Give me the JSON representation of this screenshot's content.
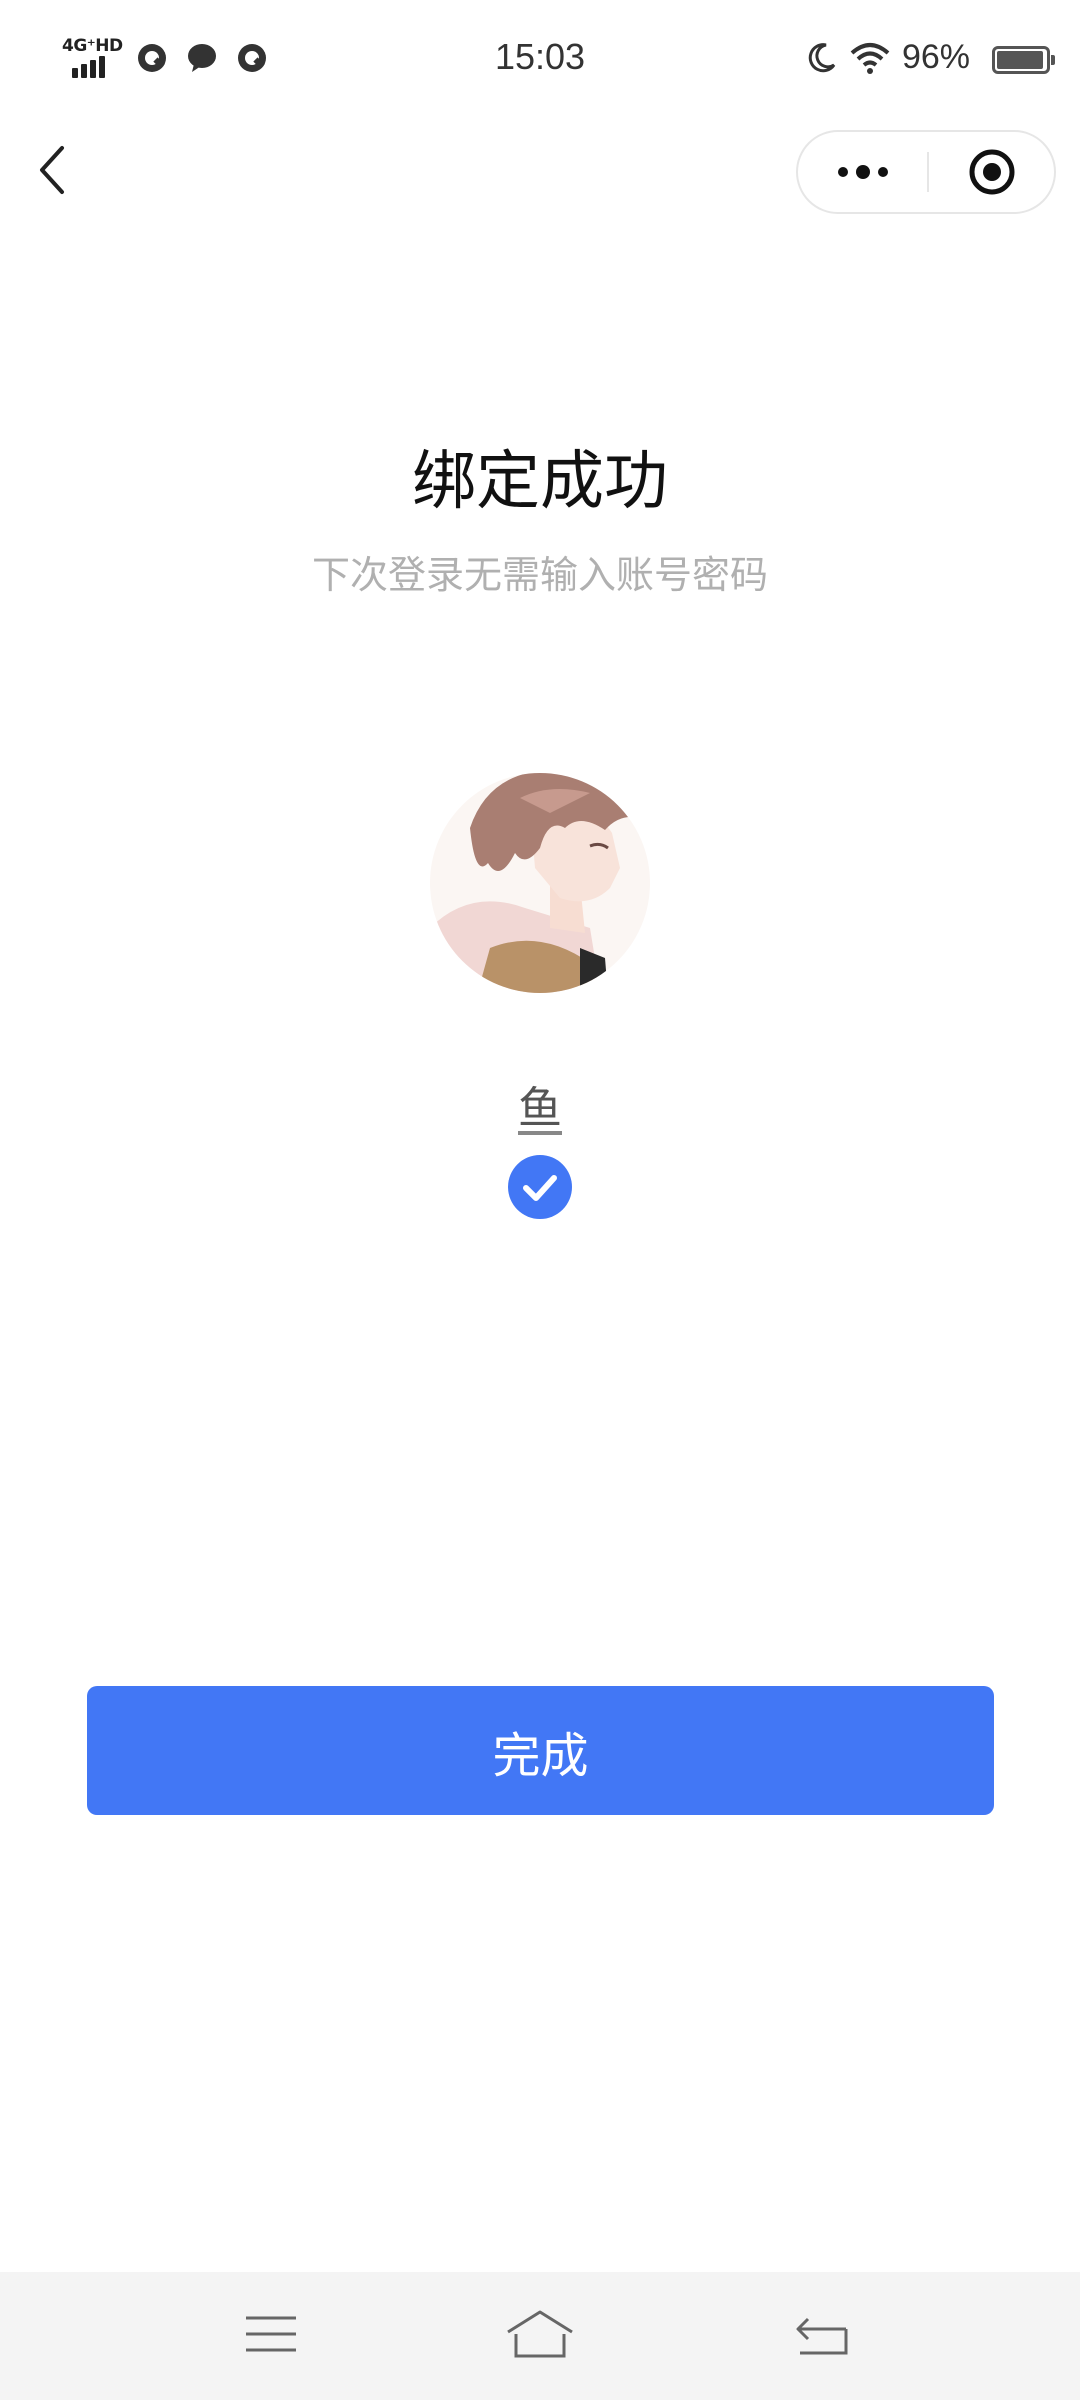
{
  "status_bar": {
    "network_label": "4G⁺HD",
    "time": "15:03",
    "battery_percent": "96%",
    "battery_level": 0.96,
    "icons": [
      "signal-icon",
      "app-notification-icon",
      "chat-icon",
      "app-notification-icon",
      "moon-icon",
      "wifi-icon",
      "battery-icon"
    ]
  },
  "nav": {
    "back_icon": "chevron-left-icon",
    "more_icon": "more-dots-icon",
    "close_icon": "close-target-icon"
  },
  "content": {
    "title": "绑定成功",
    "subtitle": "下次登录无需输入账号密码",
    "avatar_icon": "avatar",
    "username": "鱼",
    "selected_icon": "check-circle-icon"
  },
  "primary_button": {
    "label": "完成"
  },
  "system_nav": {
    "icons": [
      "menu-icon",
      "home-icon",
      "back-return-icon"
    ]
  },
  "colors": {
    "accent": "#4277f5",
    "subtitle_text": "#b0b0b0",
    "system_nav_bg": "#f4f4f4"
  }
}
